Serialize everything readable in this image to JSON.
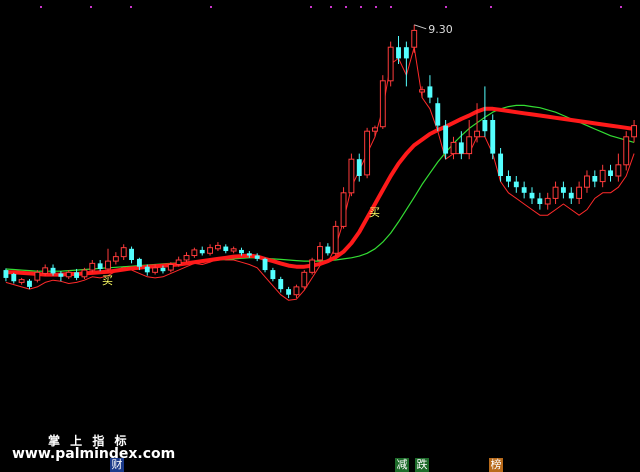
{
  "chart_data": {
    "type": "candlestick",
    "y_range": [
      2.6,
      9.6
    ],
    "peak_label": "9.30",
    "buy_markers": [
      {
        "label": "买",
        "index": 13
      },
      {
        "label": "买",
        "index": 47
      }
    ],
    "candles": [
      {
        "o": 4.78,
        "c": 4.92,
        "h": 4.95,
        "l": 4.72,
        "up": false
      },
      {
        "o": 4.72,
        "c": 4.85,
        "h": 4.87,
        "l": 4.68,
        "up": false
      },
      {
        "o": 4.7,
        "c": 4.75,
        "h": 4.78,
        "l": 4.66,
        "up": true
      },
      {
        "o": 4.73,
        "c": 4.62,
        "h": 4.76,
        "l": 4.58,
        "up": false
      },
      {
        "o": 4.74,
        "c": 4.88,
        "h": 4.92,
        "l": 4.7,
        "up": true
      },
      {
        "o": 4.86,
        "c": 4.96,
        "h": 5.02,
        "l": 4.82,
        "up": true
      },
      {
        "o": 4.96,
        "c": 4.86,
        "h": 5.02,
        "l": 4.82,
        "up": false
      },
      {
        "o": 4.86,
        "c": 4.8,
        "h": 4.9,
        "l": 4.72,
        "up": false
      },
      {
        "o": 4.8,
        "c": 4.88,
        "h": 4.92,
        "l": 4.76,
        "up": true
      },
      {
        "o": 4.88,
        "c": 4.78,
        "h": 4.94,
        "l": 4.74,
        "up": false
      },
      {
        "o": 4.8,
        "c": 4.92,
        "h": 4.96,
        "l": 4.76,
        "up": true
      },
      {
        "o": 4.92,
        "c": 5.04,
        "h": 5.1,
        "l": 4.88,
        "up": true
      },
      {
        "o": 5.04,
        "c": 4.94,
        "h": 5.1,
        "l": 4.9,
        "up": false
      },
      {
        "o": 4.94,
        "c": 5.08,
        "h": 5.3,
        "l": 4.9,
        "up": true
      },
      {
        "o": 5.08,
        "c": 5.16,
        "h": 5.24,
        "l": 5.02,
        "up": true
      },
      {
        "o": 5.16,
        "c": 5.32,
        "h": 5.38,
        "l": 5.1,
        "up": true
      },
      {
        "o": 5.3,
        "c": 5.1,
        "h": 5.34,
        "l": 5.04,
        "up": false
      },
      {
        "o": 5.12,
        "c": 4.98,
        "h": 5.14,
        "l": 4.92,
        "up": false
      },
      {
        "o": 4.98,
        "c": 4.88,
        "h": 5.02,
        "l": 4.82,
        "up": false
      },
      {
        "o": 4.88,
        "c": 4.96,
        "h": 5.02,
        "l": 4.84,
        "up": true
      },
      {
        "o": 4.96,
        "c": 4.9,
        "h": 5.0,
        "l": 4.86,
        "up": false
      },
      {
        "o": 4.92,
        "c": 5.02,
        "h": 5.06,
        "l": 4.88,
        "up": true
      },
      {
        "o": 5.02,
        "c": 5.1,
        "h": 5.16,
        "l": 4.98,
        "up": true
      },
      {
        "o": 5.1,
        "c": 5.18,
        "h": 5.24,
        "l": 5.06,
        "up": true
      },
      {
        "o": 5.18,
        "c": 5.28,
        "h": 5.32,
        "l": 5.14,
        "up": true
      },
      {
        "o": 5.28,
        "c": 5.22,
        "h": 5.34,
        "l": 5.18,
        "up": false
      },
      {
        "o": 5.22,
        "c": 5.32,
        "h": 5.38,
        "l": 5.18,
        "up": true
      },
      {
        "o": 5.3,
        "c": 5.36,
        "h": 5.42,
        "l": 5.26,
        "up": true
      },
      {
        "o": 5.34,
        "c": 5.26,
        "h": 5.38,
        "l": 5.22,
        "up": false
      },
      {
        "o": 5.26,
        "c": 5.3,
        "h": 5.34,
        "l": 5.22,
        "up": true
      },
      {
        "o": 5.28,
        "c": 5.22,
        "h": 5.32,
        "l": 5.18,
        "up": false
      },
      {
        "o": 5.22,
        "c": 5.18,
        "h": 5.26,
        "l": 5.14,
        "up": false
      },
      {
        "o": 5.18,
        "c": 5.12,
        "h": 5.22,
        "l": 5.08,
        "up": false
      },
      {
        "o": 5.12,
        "c": 4.92,
        "h": 5.14,
        "l": 4.88,
        "up": false
      },
      {
        "o": 4.92,
        "c": 4.76,
        "h": 4.96,
        "l": 4.72,
        "up": false
      },
      {
        "o": 4.76,
        "c": 4.58,
        "h": 4.8,
        "l": 4.52,
        "up": false
      },
      {
        "o": 4.58,
        "c": 4.48,
        "h": 4.62,
        "l": 4.42,
        "up": false
      },
      {
        "o": 4.48,
        "c": 4.62,
        "h": 4.66,
        "l": 4.42,
        "up": true
      },
      {
        "o": 4.62,
        "c": 4.88,
        "h": 4.92,
        "l": 4.58,
        "up": true
      },
      {
        "o": 4.88,
        "c": 5.1,
        "h": 5.14,
        "l": 4.84,
        "up": true
      },
      {
        "o": 5.1,
        "c": 5.34,
        "h": 5.42,
        "l": 5.06,
        "up": true
      },
      {
        "o": 5.34,
        "c": 5.22,
        "h": 5.4,
        "l": 5.18,
        "up": false
      },
      {
        "o": 5.22,
        "c": 5.7,
        "h": 5.8,
        "l": 5.18,
        "up": true
      },
      {
        "o": 5.7,
        "c": 6.3,
        "h": 6.4,
        "l": 5.66,
        "up": true
      },
      {
        "o": 6.3,
        "c": 6.9,
        "h": 7.0,
        "l": 6.24,
        "up": true
      },
      {
        "o": 6.9,
        "c": 6.6,
        "h": 7.0,
        "l": 6.5,
        "up": false
      },
      {
        "o": 6.62,
        "c": 7.4,
        "h": 7.46,
        "l": 6.56,
        "up": true
      },
      {
        "o": 7.4,
        "c": 7.46,
        "h": 7.5,
        "l": 7.3,
        "up": true
      },
      {
        "o": 7.48,
        "c": 8.3,
        "h": 8.4,
        "l": 7.44,
        "up": true
      },
      {
        "o": 8.3,
        "c": 8.9,
        "h": 9.0,
        "l": 8.2,
        "up": true
      },
      {
        "o": 8.9,
        "c": 8.7,
        "h": 9.1,
        "l": 8.6,
        "up": false
      },
      {
        "o": 8.7,
        "c": 8.9,
        "h": 9.0,
        "l": 8.2,
        "up": false
      },
      {
        "o": 8.9,
        "c": 9.2,
        "h": 9.3,
        "l": 8.8,
        "up": true
      },
      {
        "o": 8.1,
        "c": 8.14,
        "h": 8.2,
        "l": 8.0,
        "up": true
      },
      {
        "o": 8.2,
        "c": 8.0,
        "h": 8.4,
        "l": 7.9,
        "up": false
      },
      {
        "o": 7.9,
        "c": 7.5,
        "h": 8.0,
        "l": 7.4,
        "up": false
      },
      {
        "o": 7.5,
        "c": 7.0,
        "h": 7.6,
        "l": 6.9,
        "up": false
      },
      {
        "o": 7.0,
        "c": 7.2,
        "h": 7.3,
        "l": 6.9,
        "up": true
      },
      {
        "o": 7.2,
        "c": 7.0,
        "h": 7.4,
        "l": 6.9,
        "up": false
      },
      {
        "o": 7.0,
        "c": 7.3,
        "h": 7.6,
        "l": 6.9,
        "up": true
      },
      {
        "o": 7.3,
        "c": 7.4,
        "h": 7.9,
        "l": 7.2,
        "up": true
      },
      {
        "o": 7.4,
        "c": 7.6,
        "h": 8.2,
        "l": 7.3,
        "up": false
      },
      {
        "o": 7.6,
        "c": 7.0,
        "h": 7.7,
        "l": 6.9,
        "up": false
      },
      {
        "o": 7.0,
        "c": 6.6,
        "h": 7.1,
        "l": 6.5,
        "up": false
      },
      {
        "o": 6.6,
        "c": 6.5,
        "h": 6.7,
        "l": 6.4,
        "up": false
      },
      {
        "o": 6.5,
        "c": 6.4,
        "h": 6.6,
        "l": 6.3,
        "up": false
      },
      {
        "o": 6.4,
        "c": 6.3,
        "h": 6.5,
        "l": 6.2,
        "up": false
      },
      {
        "o": 6.3,
        "c": 6.2,
        "h": 6.4,
        "l": 6.1,
        "up": false
      },
      {
        "o": 6.2,
        "c": 6.1,
        "h": 6.3,
        "l": 6.0,
        "up": false
      },
      {
        "o": 6.1,
        "c": 6.2,
        "h": 6.3,
        "l": 6.0,
        "up": true
      },
      {
        "o": 6.2,
        "c": 6.4,
        "h": 6.5,
        "l": 6.1,
        "up": true
      },
      {
        "o": 6.4,
        "c": 6.3,
        "h": 6.5,
        "l": 6.2,
        "up": false
      },
      {
        "o": 6.3,
        "c": 6.2,
        "h": 6.4,
        "l": 6.1,
        "up": false
      },
      {
        "o": 6.2,
        "c": 6.4,
        "h": 6.5,
        "l": 6.1,
        "up": true
      },
      {
        "o": 6.4,
        "c": 6.6,
        "h": 6.7,
        "l": 6.3,
        "up": true
      },
      {
        "o": 6.6,
        "c": 6.5,
        "h": 6.7,
        "l": 6.4,
        "up": false
      },
      {
        "o": 6.5,
        "c": 6.7,
        "h": 6.8,
        "l": 6.4,
        "up": true
      },
      {
        "o": 6.7,
        "c": 6.6,
        "h": 6.8,
        "l": 6.5,
        "up": false
      },
      {
        "o": 6.6,
        "c": 6.8,
        "h": 7.0,
        "l": 6.5,
        "up": true
      },
      {
        "o": 6.8,
        "c": 7.3,
        "h": 7.4,
        "l": 6.7,
        "up": true
      },
      {
        "o": 7.3,
        "c": 7.5,
        "h": 7.6,
        "l": 7.2,
        "up": true
      }
    ],
    "series": [
      {
        "line": "thick-red",
        "values": [
          4.88,
          4.88,
          4.87,
          4.86,
          4.85,
          4.84,
          4.84,
          4.84,
          4.85,
          4.85,
          4.86,
          4.87,
          4.88,
          4.89,
          4.91,
          4.93,
          4.95,
          4.96,
          4.98,
          4.99,
          5.0,
          5.01,
          5.02,
          5.04,
          5.06,
          5.08,
          5.1,
          5.12,
          5.14,
          5.16,
          5.17,
          5.18,
          5.16,
          5.12,
          5.08,
          5.04,
          5.0,
          4.98,
          4.98,
          5.0,
          5.03,
          5.08,
          5.15,
          5.25,
          5.4,
          5.6,
          5.85,
          6.1,
          6.35,
          6.6,
          6.82,
          7.0,
          7.15,
          7.25,
          7.35,
          7.42,
          7.48,
          7.55,
          7.62,
          7.68,
          7.75,
          7.8,
          7.8,
          7.78,
          7.76,
          7.74,
          7.72,
          7.7,
          7.68,
          7.66,
          7.64,
          7.62,
          7.6,
          7.58,
          7.56,
          7.54,
          7.52,
          7.5,
          7.48,
          7.46,
          7.44
        ]
      },
      {
        "line": "green",
        "values": [
          4.94,
          4.93,
          4.92,
          4.91,
          4.9,
          4.9,
          4.9,
          4.9,
          4.91,
          4.92,
          4.93,
          4.94,
          4.95,
          4.96,
          4.97,
          4.98,
          4.99,
          5.0,
          5.01,
          5.02,
          5.03,
          5.04,
          5.05,
          5.06,
          5.07,
          5.08,
          5.09,
          5.1,
          5.11,
          5.12,
          5.13,
          5.14,
          5.14,
          5.13,
          5.12,
          5.11,
          5.1,
          5.09,
          5.08,
          5.08,
          5.08,
          5.09,
          5.1,
          5.12,
          5.14,
          5.17,
          5.22,
          5.3,
          5.42,
          5.58,
          5.78,
          6.0,
          6.22,
          6.45,
          6.65,
          6.85,
          7.02,
          7.18,
          7.32,
          7.45,
          7.55,
          7.65,
          7.74,
          7.8,
          7.84,
          7.86,
          7.86,
          7.84,
          7.82,
          7.78,
          7.74,
          7.68,
          7.62,
          7.56,
          7.5,
          7.44,
          7.38,
          7.32,
          7.28,
          7.24,
          7.2
        ]
      },
      {
        "line": "thin-red",
        "values": [
          4.7,
          4.66,
          4.62,
          4.58,
          4.62,
          4.7,
          4.74,
          4.72,
          4.68,
          4.7,
          4.74,
          4.8,
          4.78,
          4.82,
          4.9,
          4.98,
          4.92,
          4.86,
          4.8,
          4.78,
          4.8,
          4.86,
          4.92,
          4.98,
          5.04,
          5.02,
          5.06,
          5.12,
          5.1,
          5.1,
          5.06,
          5.02,
          4.96,
          4.8,
          4.64,
          4.48,
          4.38,
          4.4,
          4.56,
          4.78,
          5.0,
          5.06,
          5.34,
          5.8,
          6.4,
          6.7,
          7.0,
          7.3,
          7.8,
          8.6,
          8.7,
          8.4,
          8.9,
          8.0,
          7.8,
          7.4,
          6.9,
          7.0,
          7.0,
          7.0,
          7.3,
          7.3,
          7.0,
          6.5,
          6.3,
          6.2,
          6.1,
          6.0,
          5.9,
          5.9,
          6.0,
          6.1,
          6.0,
          5.9,
          6.0,
          6.2,
          6.3,
          6.3,
          6.4,
          6.6,
          7.0
        ]
      }
    ],
    "bottom_labels": {
      "indicator": "掌 上 指 标",
      "watermark": "www.palmindex.com",
      "tab_cai": "财",
      "tab_jian": "减",
      "tab_die": "跌",
      "tab_bang": "榜"
    },
    "colors": {
      "up": "#ff3b3b",
      "down": "#54ffff",
      "thick_line": "#ff1a1a",
      "green_line": "#33dd33",
      "thin_line": "#ff2a2a",
      "top_dots": "#cc33cc",
      "buy_text": "#ffff66"
    }
  }
}
